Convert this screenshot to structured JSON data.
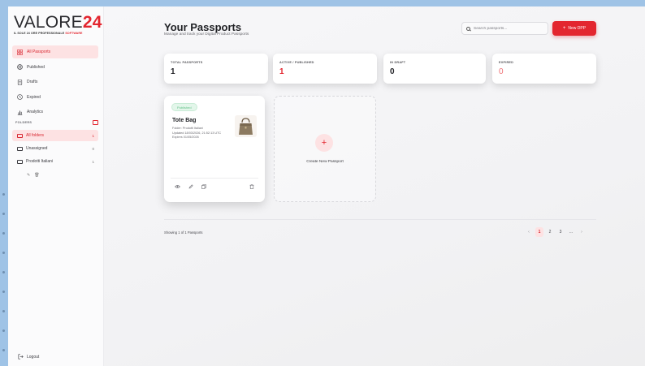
{
  "brand": {
    "logo_main": "VALORE",
    "logo_accent": "24",
    "tagline_main": "IL SOLE 24 ORE PROFESSIONALE",
    "tagline_accent": "SOFTWARE",
    "accent_color": "#e3262f"
  },
  "sidebar": {
    "nav": [
      {
        "label": "All Passports",
        "icon": "grid-icon",
        "active": true
      },
      {
        "label": "Published",
        "icon": "globe-icon",
        "active": false
      },
      {
        "label": "Drafts",
        "icon": "document-icon",
        "active": false
      },
      {
        "label": "Expired",
        "icon": "clock-icon",
        "active": false
      },
      {
        "label": "Analytics",
        "icon": "bar-chart-icon",
        "active": false
      }
    ],
    "folders_heading": "FOLDERS",
    "folders": [
      {
        "label": "All folders",
        "count": "1",
        "active": true
      },
      {
        "label": "Unassigned",
        "count": "0",
        "active": false
      },
      {
        "label": "Prodotti Italiani",
        "count": "1",
        "active": false
      }
    ],
    "logout_label": "Logout"
  },
  "header": {
    "title": "Your Passports",
    "subtitle": "Manage and track your Digital Product Passports",
    "search_placeholder": "Search passports...",
    "new_button_label": "New DPP"
  },
  "stats": [
    {
      "label": "TOTAL PASSPORTS",
      "value": "1"
    },
    {
      "label": "ACTIVE / PUBLISHED",
      "value": "1"
    },
    {
      "label": "IN DRAFT",
      "value": "0"
    },
    {
      "label": "EXPIRED",
      "value": "0"
    }
  ],
  "passport_card": {
    "status": "Published",
    "name": "Tote Bag",
    "folder": "Folder: Prodotti Italiani",
    "updated": "Updated 18/03/2026, 21:52:13 UTC",
    "expires": "Expires 01/05/2026"
  },
  "create_card": {
    "label": "Create New Passport"
  },
  "footer": {
    "showing": "Showing 1 of 1 Passports",
    "pages": [
      "1",
      "2",
      "3",
      "..."
    ]
  }
}
